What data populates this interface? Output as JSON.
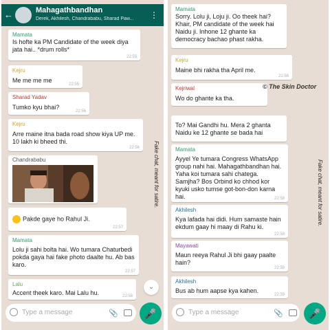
{
  "left_chat": {
    "title": "Mahagathbandhan",
    "members": "Derek, Akhilesh, Chandrababu, Sharad Paw...",
    "messages": [
      {
        "sender": "Mamata",
        "sender_color": "#2e9e6b",
        "text": "Is hofte ka PM Candidate of the week diya jata hai.. *drum rolls*",
        "time": "22:55"
      },
      {
        "sender": "Kejru",
        "sender_color": "#c7a52a",
        "text": "Me me me me",
        "time": "22:55"
      },
      {
        "sender": "Sharad Yadav",
        "sender_color": "#c0392b",
        "text": "Tumko kyu bhai?",
        "time": "22:56"
      },
      {
        "sender": "Kejru",
        "sender_color": "#c7a52a",
        "text": "Arre maine itna bada road show kiya UP me. 10 lakh ki bheed thi.",
        "time": "22:56"
      },
      {
        "sender": "Chandrababu",
        "sender_color": "#555555",
        "text": "",
        "time": ""
      },
      {
        "sender": "",
        "sender_color": "#555555",
        "text": "Pakde gaye ho Rahul Ji.",
        "time": "22:57"
      },
      {
        "sender": "Mamata",
        "sender_color": "#2e9e6b",
        "text": "Lolu ji sahi bolta hai. Wo tumara Chaturbedi pokda gaya hai fake photo daalte hu. Ab bas karo.",
        "time": "22:57"
      },
      {
        "sender": "Lalu",
        "sender_color": "#6aa84f",
        "text": "Accent theek karo. Mai Lalu hu.",
        "time": "22:58"
      }
    ],
    "placeholder": "Type a message",
    "watermark": "Fake chat, meant for satire."
  },
  "right_chat": {
    "messages": [
      {
        "sender": "Mamata",
        "sender_color": "#2e9e6b",
        "text": "Sorry. Lolu ji, Loju ji. Oo theek hai? Khair, PM candidate of the week hai Naidu ji. Inhone 12 ghante ka democracy bachao phast rakha.",
        "time": ""
      },
      {
        "sender": "Kejru",
        "sender_color": "#c7a52a",
        "text": "Maine bhi rakha tha April me.",
        "time": "22:56"
      },
      {
        "sender": "Kejriwal",
        "sender_color": "#c0392b",
        "text": "Wo do ghante ka tha.",
        "time": ""
      },
      {
        "sender": "",
        "sender_color": "#555555",
        "text": "To? Mai Gandhi hu. Mera 2 ghanta Naidu ke 12 ghante se bada hai",
        "time": ""
      },
      {
        "sender": "Mamata",
        "sender_color": "#2e9e6b",
        "text": "Ayyel Ye tumara Congress WhatsApp group nahi hai. Mahagathbandhan hai. Yaha koi tumara sahi chatega. Samjha? Bos Orbind ko chhod kor kyuki usko tumse got-bon-don karna hai.",
        "time": "22:58"
      },
      {
        "sender": "Akhilesh",
        "sender_color": "#2a6bb0",
        "text": "Kya lafada hai didi. Hum samaste hain ekdum gaay hi maay di Rahu ki.",
        "time": "22:58"
      },
      {
        "sender": "Mayawati",
        "sender_color": "#8e44ad",
        "text": "Maun reeya Rahul Ji bhi gaay paalte hain?",
        "time": "22:59"
      },
      {
        "sender": "Akhilesh",
        "sender_color": "#2a6bb0",
        "text": "Bus ab hum aapse kya kahen.",
        "time": "22:59"
      }
    ],
    "placeholder": "Type a message",
    "watermark": "Fake chat, meant for satire."
  },
  "logo_text": "© The Skin Doctor"
}
